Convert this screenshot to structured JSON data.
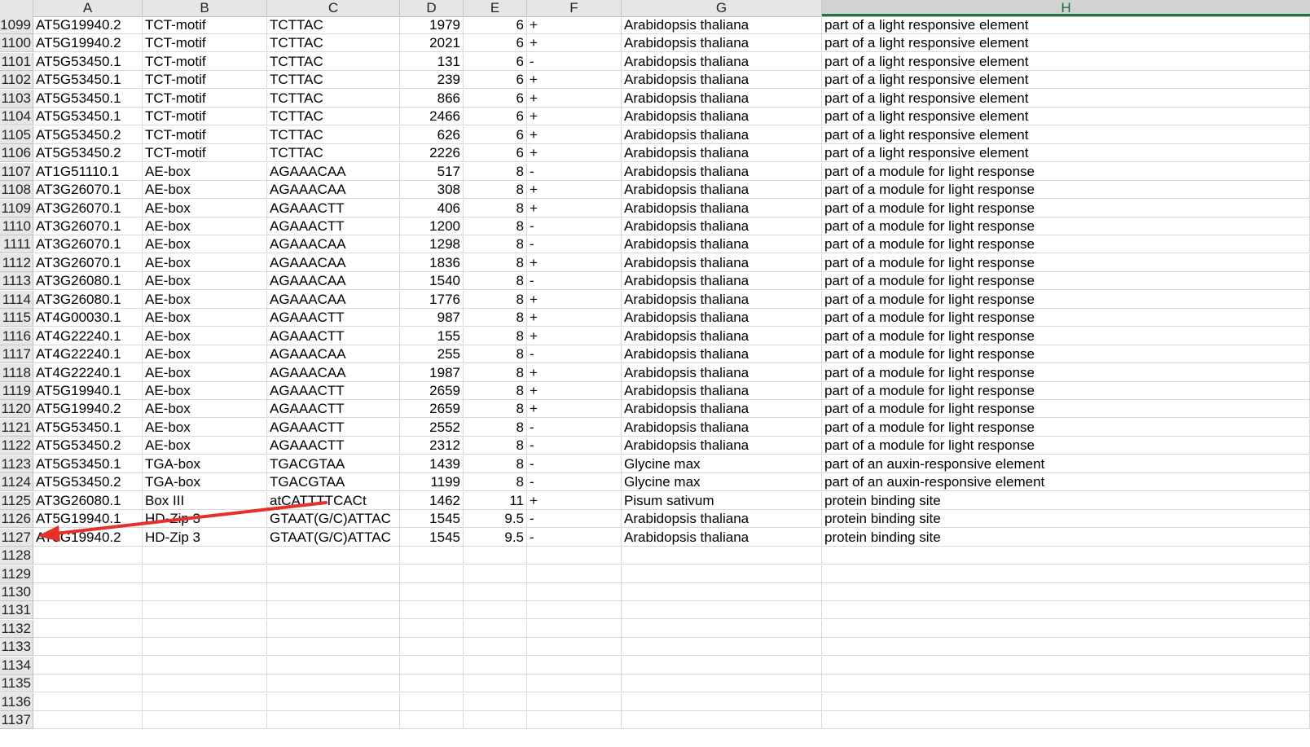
{
  "columns": [
    "A",
    "B",
    "C",
    "D",
    "E",
    "F",
    "G",
    "H"
  ],
  "active_column": "H",
  "rows": [
    {
      "n": "1099",
      "a": "AT5G19940.2",
      "b": "TCT-motif",
      "c": "TCTTAC",
      "d": "1979",
      "e": "6",
      "f": "+",
      "g": "Arabidopsis thaliana",
      "h": "part of a light responsive element"
    },
    {
      "n": "1100",
      "a": "AT5G19940.2",
      "b": "TCT-motif",
      "c": "TCTTAC",
      "d": "2021",
      "e": "6",
      "f": "+",
      "g": "Arabidopsis thaliana",
      "h": "part of a light responsive element"
    },
    {
      "n": "1101",
      "a": "AT5G53450.1",
      "b": "TCT-motif",
      "c": "TCTTAC",
      "d": "131",
      "e": "6",
      "f": "-",
      "g": "Arabidopsis thaliana",
      "h": "part of a light responsive element"
    },
    {
      "n": "1102",
      "a": "AT5G53450.1",
      "b": "TCT-motif",
      "c": "TCTTAC",
      "d": "239",
      "e": "6",
      "f": "+",
      "g": "Arabidopsis thaliana",
      "h": "part of a light responsive element"
    },
    {
      "n": "1103",
      "a": "AT5G53450.1",
      "b": "TCT-motif",
      "c": "TCTTAC",
      "d": "866",
      "e": "6",
      "f": "+",
      "g": "Arabidopsis thaliana",
      "h": "part of a light responsive element"
    },
    {
      "n": "1104",
      "a": "AT5G53450.1",
      "b": "TCT-motif",
      "c": "TCTTAC",
      "d": "2466",
      "e": "6",
      "f": "+",
      "g": "Arabidopsis thaliana",
      "h": "part of a light responsive element"
    },
    {
      "n": "1105",
      "a": "AT5G53450.2",
      "b": "TCT-motif",
      "c": "TCTTAC",
      "d": "626",
      "e": "6",
      "f": "+",
      "g": "Arabidopsis thaliana",
      "h": "part of a light responsive element"
    },
    {
      "n": "1106",
      "a": "AT5G53450.2",
      "b": "TCT-motif",
      "c": "TCTTAC",
      "d": "2226",
      "e": "6",
      "f": "+",
      "g": "Arabidopsis thaliana",
      "h": "part of a light responsive element"
    },
    {
      "n": "1107",
      "a": "AT1G51110.1",
      "b": "AE-box",
      "c": "AGAAACAA",
      "d": "517",
      "e": "8",
      "f": "-",
      "g": "Arabidopsis thaliana",
      "h": "part of a module for light response"
    },
    {
      "n": "1108",
      "a": "AT3G26070.1",
      "b": "AE-box",
      "c": "AGAAACAA",
      "d": "308",
      "e": "8",
      "f": "+",
      "g": "Arabidopsis thaliana",
      "h": "part of a module for light response"
    },
    {
      "n": "1109",
      "a": "AT3G26070.1",
      "b": "AE-box",
      "c": "AGAAACTT",
      "d": "406",
      "e": "8",
      "f": "+",
      "g": "Arabidopsis thaliana",
      "h": "part of a module for light response"
    },
    {
      "n": "1110",
      "a": "AT3G26070.1",
      "b": "AE-box",
      "c": "AGAAACTT",
      "d": "1200",
      "e": "8",
      "f": "-",
      "g": "Arabidopsis thaliana",
      "h": "part of a module for light response"
    },
    {
      "n": "1111",
      "a": "AT3G26070.1",
      "b": "AE-box",
      "c": "AGAAACAA",
      "d": "1298",
      "e": "8",
      "f": "-",
      "g": "Arabidopsis thaliana",
      "h": "part of a module for light response"
    },
    {
      "n": "1112",
      "a": "AT3G26070.1",
      "b": "AE-box",
      "c": "AGAAACAA",
      "d": "1836",
      "e": "8",
      "f": "+",
      "g": "Arabidopsis thaliana",
      "h": "part of a module for light response"
    },
    {
      "n": "1113",
      "a": "AT3G26080.1",
      "b": "AE-box",
      "c": "AGAAACAA",
      "d": "1540",
      "e": "8",
      "f": "-",
      "g": "Arabidopsis thaliana",
      "h": "part of a module for light response"
    },
    {
      "n": "1114",
      "a": "AT3G26080.1",
      "b": "AE-box",
      "c": "AGAAACAA",
      "d": "1776",
      "e": "8",
      "f": "+",
      "g": "Arabidopsis thaliana",
      "h": "part of a module for light response"
    },
    {
      "n": "1115",
      "a": "AT4G00030.1",
      "b": "AE-box",
      "c": "AGAAACTT",
      "d": "987",
      "e": "8",
      "f": "+",
      "g": "Arabidopsis thaliana",
      "h": "part of a module for light response"
    },
    {
      "n": "1116",
      "a": "AT4G22240.1",
      "b": "AE-box",
      "c": "AGAAACTT",
      "d": "155",
      "e": "8",
      "f": "+",
      "g": "Arabidopsis thaliana",
      "h": "part of a module for light response"
    },
    {
      "n": "1117",
      "a": "AT4G22240.1",
      "b": "AE-box",
      "c": "AGAAACAA",
      "d": "255",
      "e": "8",
      "f": "-",
      "g": "Arabidopsis thaliana",
      "h": "part of a module for light response"
    },
    {
      "n": "1118",
      "a": "AT4G22240.1",
      "b": "AE-box",
      "c": "AGAAACAA",
      "d": "1987",
      "e": "8",
      "f": "+",
      "g": "Arabidopsis thaliana",
      "h": "part of a module for light response"
    },
    {
      "n": "1119",
      "a": "AT5G19940.1",
      "b": "AE-box",
      "c": "AGAAACTT",
      "d": "2659",
      "e": "8",
      "f": "+",
      "g": "Arabidopsis thaliana",
      "h": "part of a module for light response"
    },
    {
      "n": "1120",
      "a": "AT5G19940.2",
      "b": "AE-box",
      "c": "AGAAACTT",
      "d": "2659",
      "e": "8",
      "f": "+",
      "g": "Arabidopsis thaliana",
      "h": "part of a module for light response"
    },
    {
      "n": "1121",
      "a": "AT5G53450.1",
      "b": "AE-box",
      "c": "AGAAACTT",
      "d": "2552",
      "e": "8",
      "f": "-",
      "g": "Arabidopsis thaliana",
      "h": "part of a module for light response"
    },
    {
      "n": "1122",
      "a": "AT5G53450.2",
      "b": "AE-box",
      "c": "AGAAACTT",
      "d": "2312",
      "e": "8",
      "f": "-",
      "g": "Arabidopsis thaliana",
      "h": "part of a module for light response"
    },
    {
      "n": "1123",
      "a": "AT5G53450.1",
      "b": "TGA-box",
      "c": "TGACGTAA",
      "d": "1439",
      "e": "8",
      "f": "-",
      "g": "Glycine max",
      "h": "part of an auxin-responsive element"
    },
    {
      "n": "1124",
      "a": "AT5G53450.2",
      "b": "TGA-box",
      "c": "TGACGTAA",
      "d": "1199",
      "e": "8",
      "f": "-",
      "g": "Glycine max",
      "h": "part of an auxin-responsive element"
    },
    {
      "n": "1125",
      "a": "AT3G26080.1",
      "b": "Box III",
      "c": "atCATTTTCACt",
      "d": "1462",
      "e": "11",
      "f": "+",
      "g": "Pisum sativum",
      "h": "protein binding site"
    },
    {
      "n": "1126",
      "a": "AT5G19940.1",
      "b": "HD-Zip 3",
      "c": "GTAAT(G/C)ATTAC",
      "d": "1545",
      "e": "9.5",
      "f": "-",
      "g": "Arabidopsis thaliana",
      "h": "protein binding site"
    },
    {
      "n": "1127",
      "a": "AT5G19940.2",
      "b": "HD-Zip 3",
      "c": "GTAAT(G/C)ATTAC",
      "d": "1545",
      "e": "9.5",
      "f": "-",
      "g": "Arabidopsis thaliana",
      "h": "protein binding site"
    },
    {
      "n": "1128",
      "a": "",
      "b": "",
      "c": "",
      "d": "",
      "e": "",
      "f": "",
      "g": "",
      "h": ""
    },
    {
      "n": "1129",
      "a": "",
      "b": "",
      "c": "",
      "d": "",
      "e": "",
      "f": "",
      "g": "",
      "h": ""
    },
    {
      "n": "1130",
      "a": "",
      "b": "",
      "c": "",
      "d": "",
      "e": "",
      "f": "",
      "g": "",
      "h": ""
    },
    {
      "n": "1131",
      "a": "",
      "b": "",
      "c": "",
      "d": "",
      "e": "",
      "f": "",
      "g": "",
      "h": ""
    },
    {
      "n": "1132",
      "a": "",
      "b": "",
      "c": "",
      "d": "",
      "e": "",
      "f": "",
      "g": "",
      "h": ""
    },
    {
      "n": "1133",
      "a": "",
      "b": "",
      "c": "",
      "d": "",
      "e": "",
      "f": "",
      "g": "",
      "h": ""
    },
    {
      "n": "1134",
      "a": "",
      "b": "",
      "c": "",
      "d": "",
      "e": "",
      "f": "",
      "g": "",
      "h": ""
    },
    {
      "n": "1135",
      "a": "",
      "b": "",
      "c": "",
      "d": "",
      "e": "",
      "f": "",
      "g": "",
      "h": ""
    },
    {
      "n": "1136",
      "a": "",
      "b": "",
      "c": "",
      "d": "",
      "e": "",
      "f": "",
      "g": "",
      "h": ""
    },
    {
      "n": "1137",
      "a": "",
      "b": "",
      "c": "",
      "d": "",
      "e": "",
      "f": "",
      "g": "",
      "h": ""
    }
  ],
  "annotation": {
    "color": "#e8302a"
  }
}
